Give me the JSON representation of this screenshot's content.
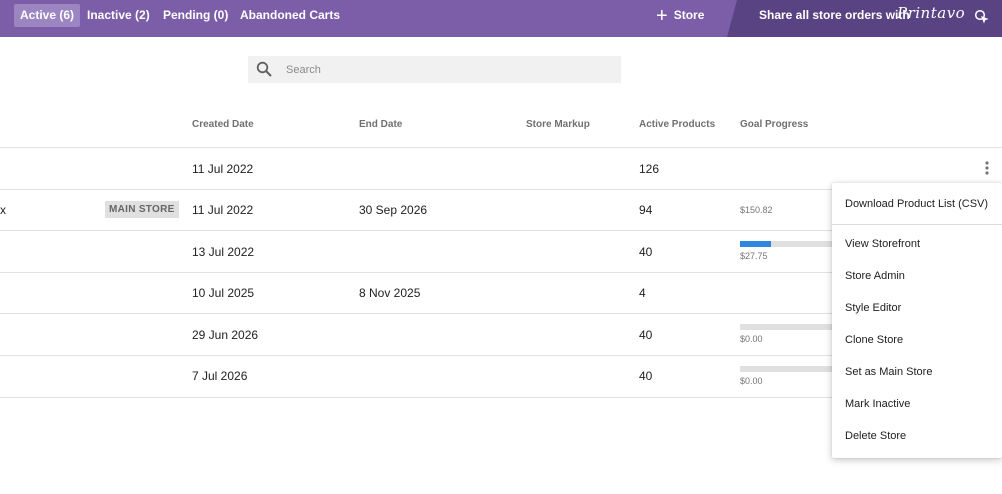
{
  "colors": {
    "topbar": "#7b5ea7",
    "promo": "#5a4382",
    "active_tab": "#9b86c2",
    "progress_fill": "#2f86e0"
  },
  "tabs": [
    {
      "label": "Active (6)",
      "active": true
    },
    {
      "label": "Inactive (2)",
      "active": false
    },
    {
      "label": "Pending (0)",
      "active": false
    },
    {
      "label": "Abandoned Carts",
      "active": false
    }
  ],
  "toolbar": {
    "add_store_label": "Store",
    "add_store_icon": "plus-icon"
  },
  "promo": {
    "text": "Share all store orders with",
    "brand": "Printavo",
    "icon": "cursor-click-icon"
  },
  "search": {
    "placeholder": "Search",
    "value": ""
  },
  "table": {
    "headers": [
      "Created Date",
      "End Date",
      "Store Markup",
      "Active Products",
      "Goal Progress"
    ],
    "rows": [
      {
        "name_fragment": "",
        "badge": "",
        "created": "11 Jul 2022",
        "end": "",
        "markup": "",
        "products": "126",
        "goal": "",
        "goal_fill": null
      },
      {
        "name_fragment": "x",
        "badge": "MAIN STORE",
        "created": "11 Jul 2022",
        "end": "30 Sep 2026",
        "markup": "",
        "products": "94",
        "goal": "$150.82",
        "goal_fill": null
      },
      {
        "name_fragment": "",
        "badge": "",
        "created": "13 Jul 2022",
        "end": "",
        "markup": "",
        "products": "40",
        "goal": "$27.75",
        "goal_fill": 0.31
      },
      {
        "name_fragment": "",
        "badge": "",
        "created": "10 Jul 2025",
        "end": "8 Nov 2025",
        "markup": "",
        "products": "4",
        "goal": "",
        "goal_fill": null
      },
      {
        "name_fragment": "",
        "badge": "",
        "created": "29 Jun 2026",
        "end": "",
        "markup": "",
        "products": "40",
        "goal": "$0.00",
        "goal_fill": 0
      },
      {
        "name_fragment": "",
        "badge": "",
        "created": "7 Jul 2026",
        "end": "",
        "markup": "",
        "products": "40",
        "goal": "$0.00",
        "goal_fill": 0
      }
    ]
  },
  "row_menu": {
    "icon": "more-vertical-icon",
    "items": [
      "Download Product List (CSV)",
      "View Storefront",
      "Store Admin",
      "Style Editor",
      "Clone Store",
      "Set as Main Store",
      "Mark Inactive",
      "Delete Store"
    ]
  }
}
